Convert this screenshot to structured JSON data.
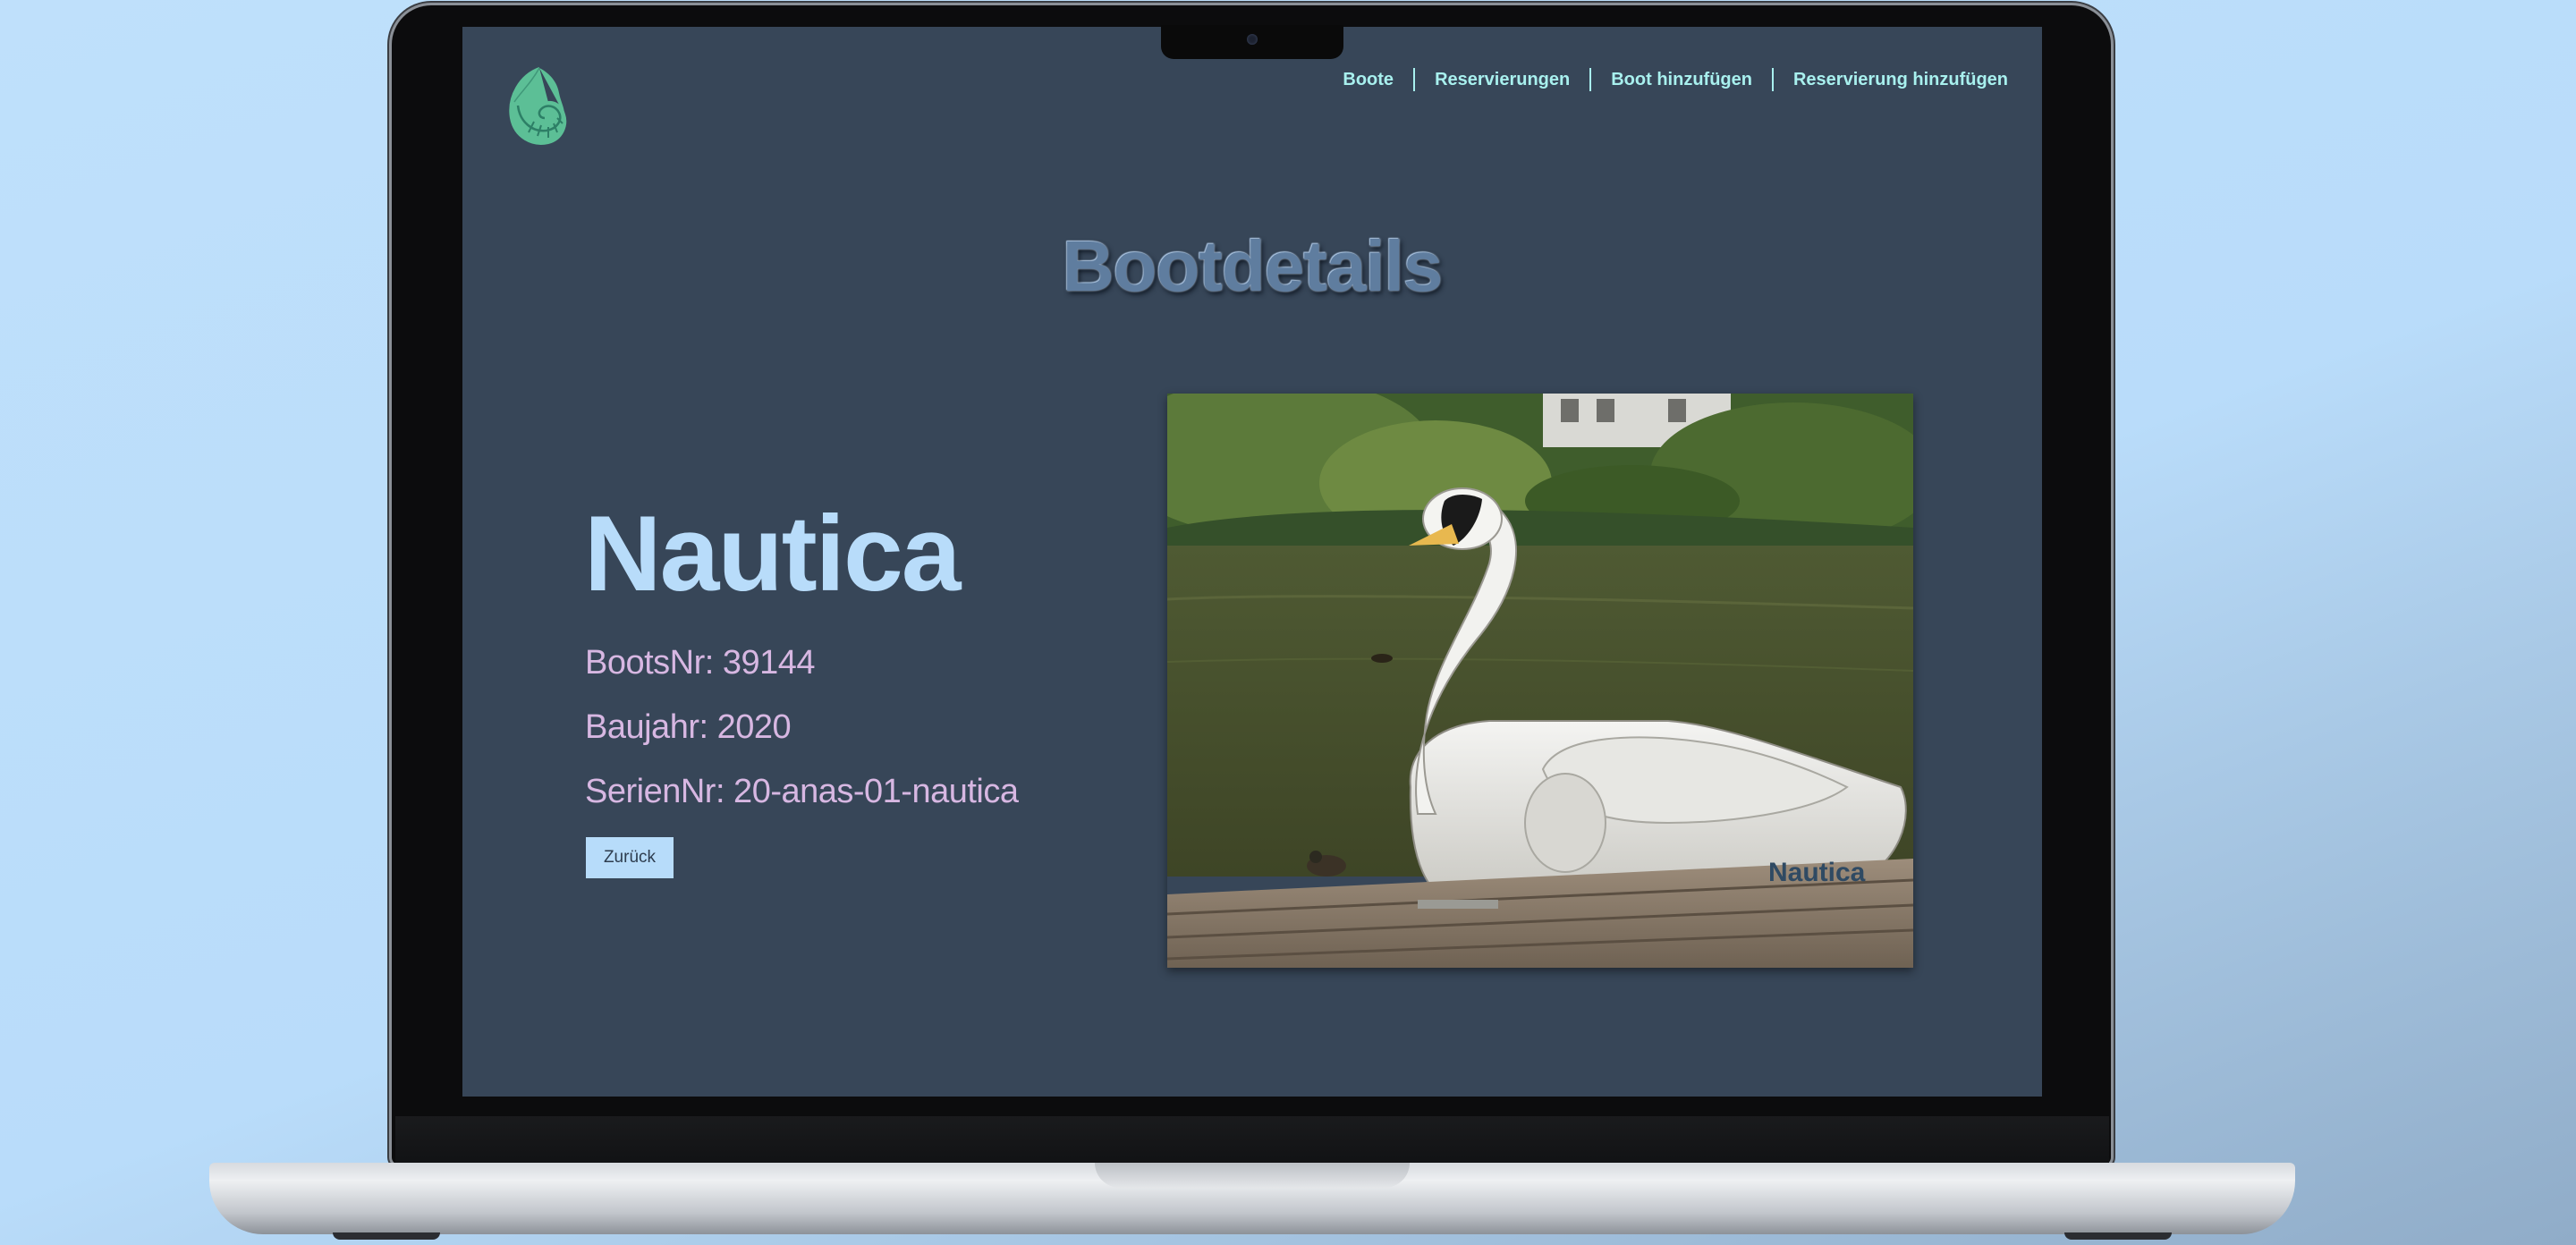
{
  "nav": {
    "items": [
      {
        "label": "Boote"
      },
      {
        "label": "Reservierungen"
      },
      {
        "label": "Boot hinzufügen"
      },
      {
        "label": "Reservierung hinzufügen"
      }
    ]
  },
  "page": {
    "title": "Bootdetails"
  },
  "boat": {
    "name": "Nautica",
    "boots_nr": "BootsNr: 39144",
    "baujahr": "Baujahr: 2020",
    "serien_nr": "SerienNr: 20-anas-01-nautica",
    "image_label": "Nautica"
  },
  "actions": {
    "back_label": "Zurück"
  },
  "colors": {
    "page_background": "#374658",
    "nav_text": "#a8f0ee",
    "boat_name": "#b8dcfa",
    "detail_text": "#d7b7e2",
    "logo": "#5cbf96"
  },
  "icons": {
    "logo": "nautilus-shell-icon"
  }
}
